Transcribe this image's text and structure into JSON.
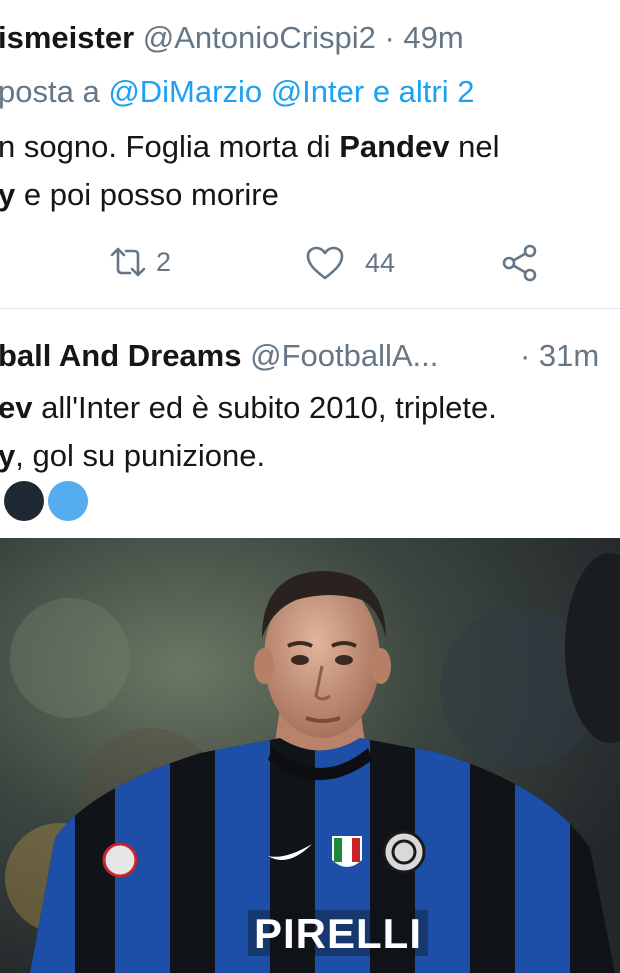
{
  "tweets": [
    {
      "name": "ismeister",
      "handle": "@AntonioCrispi2",
      "time": "· 49m",
      "reply_prefix": "posta a ",
      "reply_to_1": "@DiMarzio",
      "reply_to_2": "@Inter",
      "reply_suffix": " e altri 2",
      "line1_a": "n sogno. Foglia morta di ",
      "line1_b": "Pandev",
      "line1_c": " nel",
      "line2_a": "y",
      "line2_b": " e poi posso morire",
      "retweets": "2",
      "likes": "44"
    },
    {
      "name": "ball And Dreams",
      "handle": "@FootballA...",
      "time": "· 31m",
      "line1_a": "ev",
      "line1_b": " all'Inter ed è subito 2010, triplete.",
      "line2_a": "y",
      "line2_b": ", gol su punizione."
    }
  ],
  "emoji_dots": [
    "#1f2933",
    "#55acee"
  ],
  "photo": {
    "shirt_sponsor": "PIRELLI",
    "colors": {
      "stripe_blue": "#1d4fa8",
      "stripe_black": "#101318",
      "background": "#3a443c"
    }
  },
  "colors": {
    "text": "#14171a",
    "secondary": "#657786",
    "link": "#1da1f2",
    "divider": "#e1e8ed"
  }
}
